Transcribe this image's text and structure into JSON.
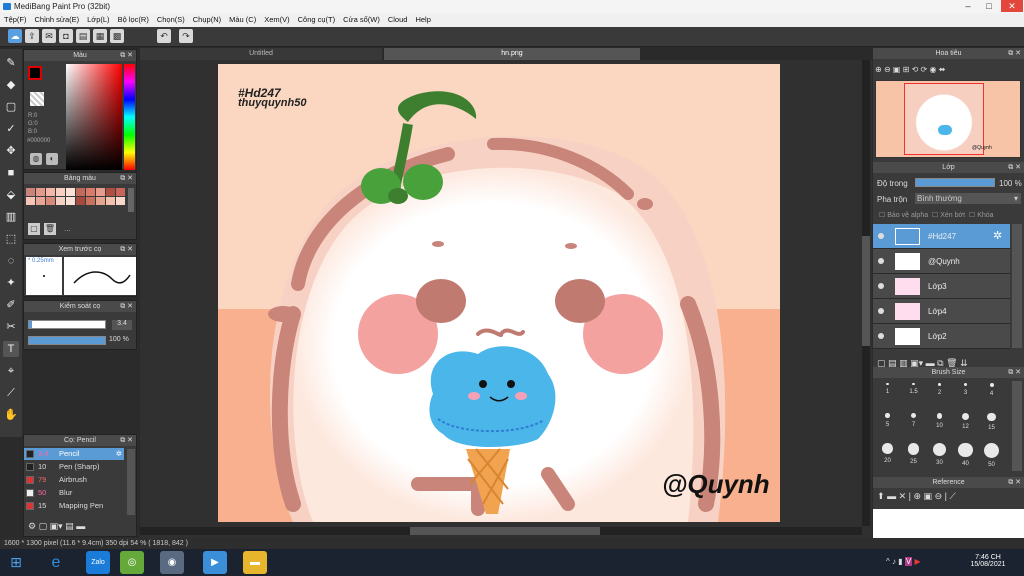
{
  "window": {
    "title": "MediBang Paint Pro (32bit)"
  },
  "menu": [
    "Tệp(F)",
    "Chỉnh sửa(E)",
    "Lớp(L)",
    "Bộ lọc(R)",
    "Chọn(S)",
    "Chụp(N)",
    "Màu (C)",
    "Xem(V)",
    "Công cụ(T)",
    "Cửa sổ(W)",
    "Cloud",
    "Help"
  ],
  "tabs": {
    "tab1": "Untitled",
    "tab2": "hn.png"
  },
  "color_panel": {
    "title": "Màu",
    "r": "R:0",
    "g": "G:0",
    "b": "B:0",
    "hex": "#000000"
  },
  "palette_panel": {
    "title": "Bảng màu",
    "more": "..."
  },
  "preview_panel": {
    "title": "Xem trước cọ",
    "size": "0.25mm"
  },
  "control_panel": {
    "title": "Kiểm soát cọ",
    "size_value": "3.4",
    "opacity_value": "100 %"
  },
  "brush_panel": {
    "title": "Cọ: Pencil",
    "items": [
      {
        "size": "3.4",
        "name": "Pencil"
      },
      {
        "size": "10",
        "name": "Pen (Sharp)"
      },
      {
        "size": "79",
        "name": "Airbrush"
      },
      {
        "size": "50",
        "name": "Blur"
      },
      {
        "size": "15",
        "name": "Mapping Pen"
      }
    ]
  },
  "navigator": {
    "title": "Hoa tiêu",
    "thumb_text": "@Quynh"
  },
  "layer_panel": {
    "title": "Lớp",
    "opacity_label": "Độ trong",
    "opacity_value": "100 %",
    "blend_label": "Pha trộn",
    "blend_value": "Bình thường",
    "protect_alpha": "Bảo vệ alpha",
    "clipping": "Xén bớt",
    "lock": "Khóa",
    "layers": [
      "#Hd247",
      "@Quynh",
      "Lớp3",
      "Lớp4",
      "Lớp2"
    ]
  },
  "brush_size_panel": {
    "title": "Brush Size",
    "labels": [
      "1",
      "1.5",
      "2",
      "3",
      "4",
      "5",
      "7",
      "10",
      "12",
      "15",
      "20",
      "25",
      "30",
      "40",
      "50"
    ]
  },
  "reference_panel": {
    "title": "Reference"
  },
  "artwork": {
    "hashtag": "#Hd247",
    "author": "thuyquynh50",
    "signature": "@Quynh"
  },
  "status": {
    "text": "1600 * 1300 pixel  (11.6 * 9.4cm)  350 dpi  54 %  ( 1818, 842 )"
  },
  "taskbar": {
    "time": "7:46 CH",
    "date": "15/08/2021",
    "zalo": "Zalo"
  },
  "colors": {
    "accent": "#5b9bd5",
    "canvas_bg": "#fbc9ad",
    "skin": "#fff5f0",
    "outline": "#c9857a",
    "icecream": "#4ab6ea",
    "cone": "#f1a350"
  }
}
